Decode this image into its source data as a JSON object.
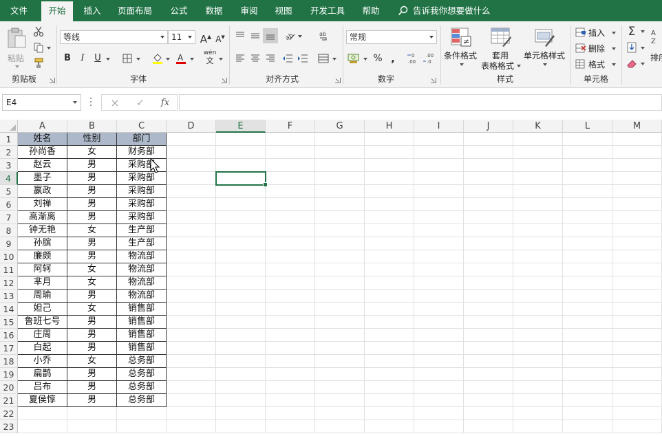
{
  "tabs": [
    {
      "label": "文件",
      "active": false
    },
    {
      "label": "开始",
      "active": true
    },
    {
      "label": "插入",
      "active": false
    },
    {
      "label": "页面布局",
      "active": false
    },
    {
      "label": "公式",
      "active": false
    },
    {
      "label": "数据",
      "active": false
    },
    {
      "label": "审阅",
      "active": false
    },
    {
      "label": "视图",
      "active": false
    },
    {
      "label": "开发工具",
      "active": false
    },
    {
      "label": "帮助",
      "active": false
    }
  ],
  "tell_me": "告诉我你想要做什么",
  "ribbon": {
    "clipboard": {
      "label": "剪贴板",
      "paste": "粘贴"
    },
    "font": {
      "label": "字体",
      "font_name": "等线",
      "font_size": "11",
      "bold": "B",
      "italic": "I",
      "underline": "U",
      "grow": "A",
      "shrink": "A",
      "wen": "wén"
    },
    "alignment": {
      "label": "对齐方式"
    },
    "number": {
      "label": "数字",
      "format": "常规",
      "percent": "%",
      "comma": ","
    },
    "styles": {
      "label": "样式",
      "conditional": "条件格式",
      "table_format_1": "套用",
      "table_format_2": "表格格式",
      "cell_styles": "单元格样式"
    },
    "cells": {
      "label": "单元格",
      "insert": "插入",
      "delete": "删除",
      "format": "格式"
    },
    "editing": {
      "sort_partial": "排序"
    }
  },
  "formula_bar": {
    "name_box": "E4",
    "fx": "fx",
    "formula": ""
  },
  "accent": "#217346",
  "header_fill": "#adb9ca",
  "columns": [
    "A",
    "B",
    "C",
    "D",
    "E",
    "F",
    "G",
    "H",
    "I",
    "J",
    "K",
    "L",
    "M"
  ],
  "selected_column": "E",
  "selected_row": "4",
  "rows": [
    "1",
    "2",
    "3",
    "4",
    "5",
    "6",
    "7",
    "8",
    "9",
    "10",
    "11",
    "12",
    "13",
    "14",
    "15",
    "16",
    "17",
    "18",
    "19",
    "20",
    "21",
    "22",
    "23"
  ],
  "table": {
    "headers": [
      "姓名",
      "性别",
      "部门"
    ],
    "rows": [
      [
        "孙尚香",
        "女",
        "财务部"
      ],
      [
        "赵云",
        "男",
        "采购部"
      ],
      [
        "墨子",
        "男",
        "采购部"
      ],
      [
        "嬴政",
        "男",
        "采购部"
      ],
      [
        "刘禅",
        "男",
        "采购部"
      ],
      [
        "高渐离",
        "男",
        "采购部"
      ],
      [
        "钟无艳",
        "女",
        "生产部"
      ],
      [
        "孙膑",
        "男",
        "生产部"
      ],
      [
        "廉颇",
        "男",
        "物流部"
      ],
      [
        "阿轲",
        "女",
        "物流部"
      ],
      [
        "芈月",
        "女",
        "物流部"
      ],
      [
        "周瑜",
        "男",
        "物流部"
      ],
      [
        "妲己",
        "女",
        "销售部"
      ],
      [
        "鲁班七号",
        "男",
        "销售部"
      ],
      [
        "庄周",
        "男",
        "销售部"
      ],
      [
        "白起",
        "男",
        "销售部"
      ],
      [
        "小乔",
        "女",
        "总务部"
      ],
      [
        "扁鹊",
        "男",
        "总务部"
      ],
      [
        "吕布",
        "男",
        "总务部"
      ],
      [
        "夏侯惇",
        "男",
        "总务部"
      ]
    ]
  }
}
